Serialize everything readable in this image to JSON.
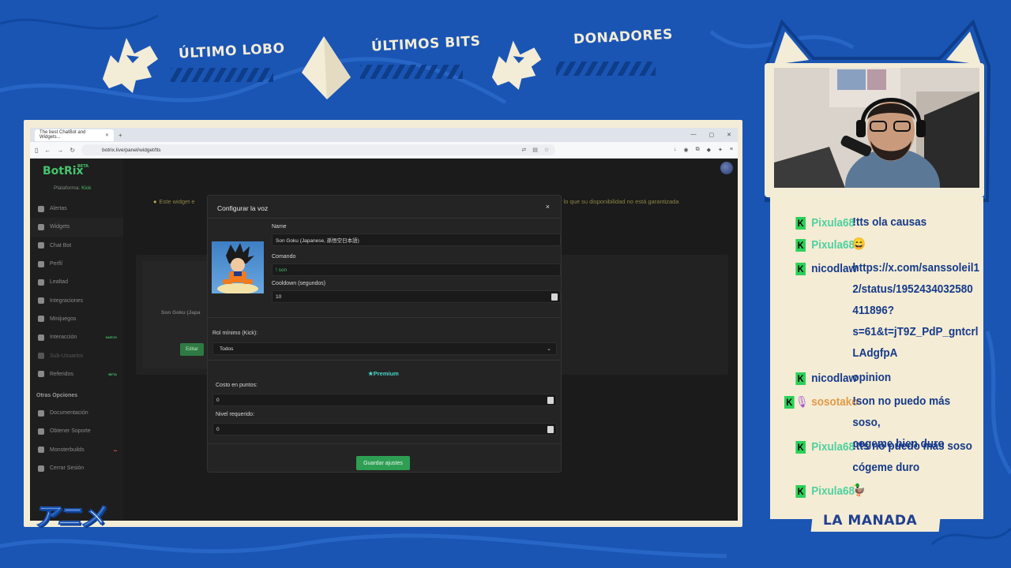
{
  "overlay": {
    "header_labels": [
      "ÚLTIMO LOBO",
      "ÚLTIMOS BITS",
      "DONADORES"
    ],
    "corner_logo": "アニメ",
    "team_label": "LA MANADA",
    "colors": {
      "background": "#1a55b4",
      "cream": "#f3ecd6",
      "accent_green": "#45c36c"
    }
  },
  "browser": {
    "tab_title": "The best ChatBot and Widgets...",
    "url": "botrix.live/panel/widget/tts"
  },
  "app": {
    "brand": "BotRix",
    "brand_badge": "BETA",
    "platform_label": "Plataforma:",
    "platform_value": "Kick",
    "menu": [
      {
        "label": "Alertas",
        "icon": "alert-icon",
        "tag": ""
      },
      {
        "label": "Widgets",
        "icon": "widgets-icon",
        "tag": ""
      },
      {
        "label": "Chat Bot",
        "icon": "chat-bot-icon",
        "tag": ""
      },
      {
        "label": "Perfil",
        "icon": "profile-icon",
        "tag": ""
      },
      {
        "label": "Lealtad",
        "icon": "trophy-icon",
        "tag": ""
      },
      {
        "label": "Integraciones",
        "icon": "integrations-icon",
        "tag": ""
      },
      {
        "label": "Minijuegos",
        "icon": "games-icon",
        "tag": ""
      },
      {
        "label": "Interacción",
        "icon": "interaction-icon",
        "tag": "NUEVO"
      },
      {
        "label": "Sub-Usuarios",
        "icon": "users-icon",
        "tag": ""
      },
      {
        "label": "Referidos",
        "icon": "referrals-icon",
        "tag": "BETA"
      }
    ],
    "other_title": "Otras Opciones",
    "other_menu": [
      {
        "label": "Documentación",
        "icon": "docs-icon",
        "tag": ""
      },
      {
        "label": "Obtener Soporte",
        "icon": "support-icon",
        "tag": ""
      },
      {
        "label": "Monsterbuilds",
        "icon": "monster-icon",
        "tag": ""
      },
      {
        "label": "Cerrar Sesión",
        "icon": "logout-icon",
        "tag": ""
      }
    ],
    "warning_left": "Este widget e",
    "warning_right": "r lo que su disponibilidad no está garantizada",
    "card_name": "Son Goku (Japa",
    "card_button": "Editar"
  },
  "modal": {
    "title": "Configurar la voz",
    "close": "×",
    "name_label": "Name",
    "name_value": "Son Goku (Japanese, 孫悟空日本語)",
    "command_label": "Comando",
    "command_value": "! son",
    "cooldown_label": "Cooldown (segundos)",
    "cooldown_value": "10",
    "role_label": "Rol mínimo (Kick):",
    "role_value": "Todos",
    "premium_label": "Premium",
    "cost_label": "Costo en puntos:",
    "cost_value": "0",
    "level_label": "Nivel requerido:",
    "level_value": "0",
    "save_label": "Guardar ajustes"
  },
  "chat": [
    {
      "user": "Pixula68",
      "user_color": "#4fd0a0",
      "text": "!tts ola causas",
      "badges": [
        "K"
      ]
    },
    {
      "user": "Pixula68",
      "user_color": "#4fd0a0",
      "text": "😄",
      "badges": [
        "K"
      ]
    },
    {
      "user": "nicodlaw",
      "user_color": "#163a8a",
      "text": "https://x.com/sanssoleil1\n2/status/1952434032580\n411896?\ns=61&t=jT9Z_PdP_gntcrl\nLAdgfpA",
      "badges": [
        "K"
      ]
    },
    {
      "user": "nicodlaw",
      "user_color": "#163a8a",
      "text": "opinion",
      "badges": [
        "K"
      ]
    },
    {
      "user": "sosotako",
      "user_color": "#e29a4a",
      "text": "!son no puedo más soso,\ncogeme bien duro",
      "badges": [
        "K",
        "mic"
      ]
    },
    {
      "user": "Pixula68",
      "user_color": "#4fd0a0",
      "text": "!tts no puedo mas soso\ncógeme duro",
      "badges": [
        "K"
      ]
    },
    {
      "user": "Pixula68",
      "user_color": "#4fd0a0",
      "text": "🦆",
      "badges": [
        "K"
      ]
    }
  ]
}
